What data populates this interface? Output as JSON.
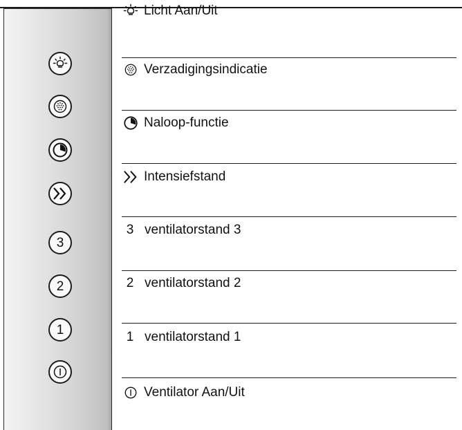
{
  "legend": {
    "light": {
      "icon": "light-bulb-icon",
      "label": "Licht Aan/Uit"
    },
    "saturation": {
      "icon": "dotted-circle-icon",
      "label": "Verzadigingsindicatie"
    },
    "runon": {
      "icon": "timer-circle-icon",
      "label": "Naloop-functie"
    },
    "intensive": {
      "icon": "double-chevron-right-icon",
      "label": "Intensiefstand"
    },
    "fan3": {
      "icon_text": "3",
      "label": "ventilatorstand 3"
    },
    "fan2": {
      "icon_text": "2",
      "label": "ventilatorstand 2"
    },
    "fan1": {
      "icon_text": "1",
      "label": "ventilatorstand 1"
    },
    "power": {
      "icon": "power-circle-icon",
      "label": "Ventilator Aan/Uit"
    }
  },
  "panel": {
    "buttons": [
      {
        "icon": "light-bulb-icon"
      },
      {
        "icon": "dotted-circle-icon"
      },
      {
        "icon": "timer-circle-icon"
      },
      {
        "icon": "double-chevron-right-icon"
      },
      {
        "text": "3"
      },
      {
        "text": "2"
      },
      {
        "text": "1"
      },
      {
        "icon": "power-circle-icon"
      }
    ]
  }
}
